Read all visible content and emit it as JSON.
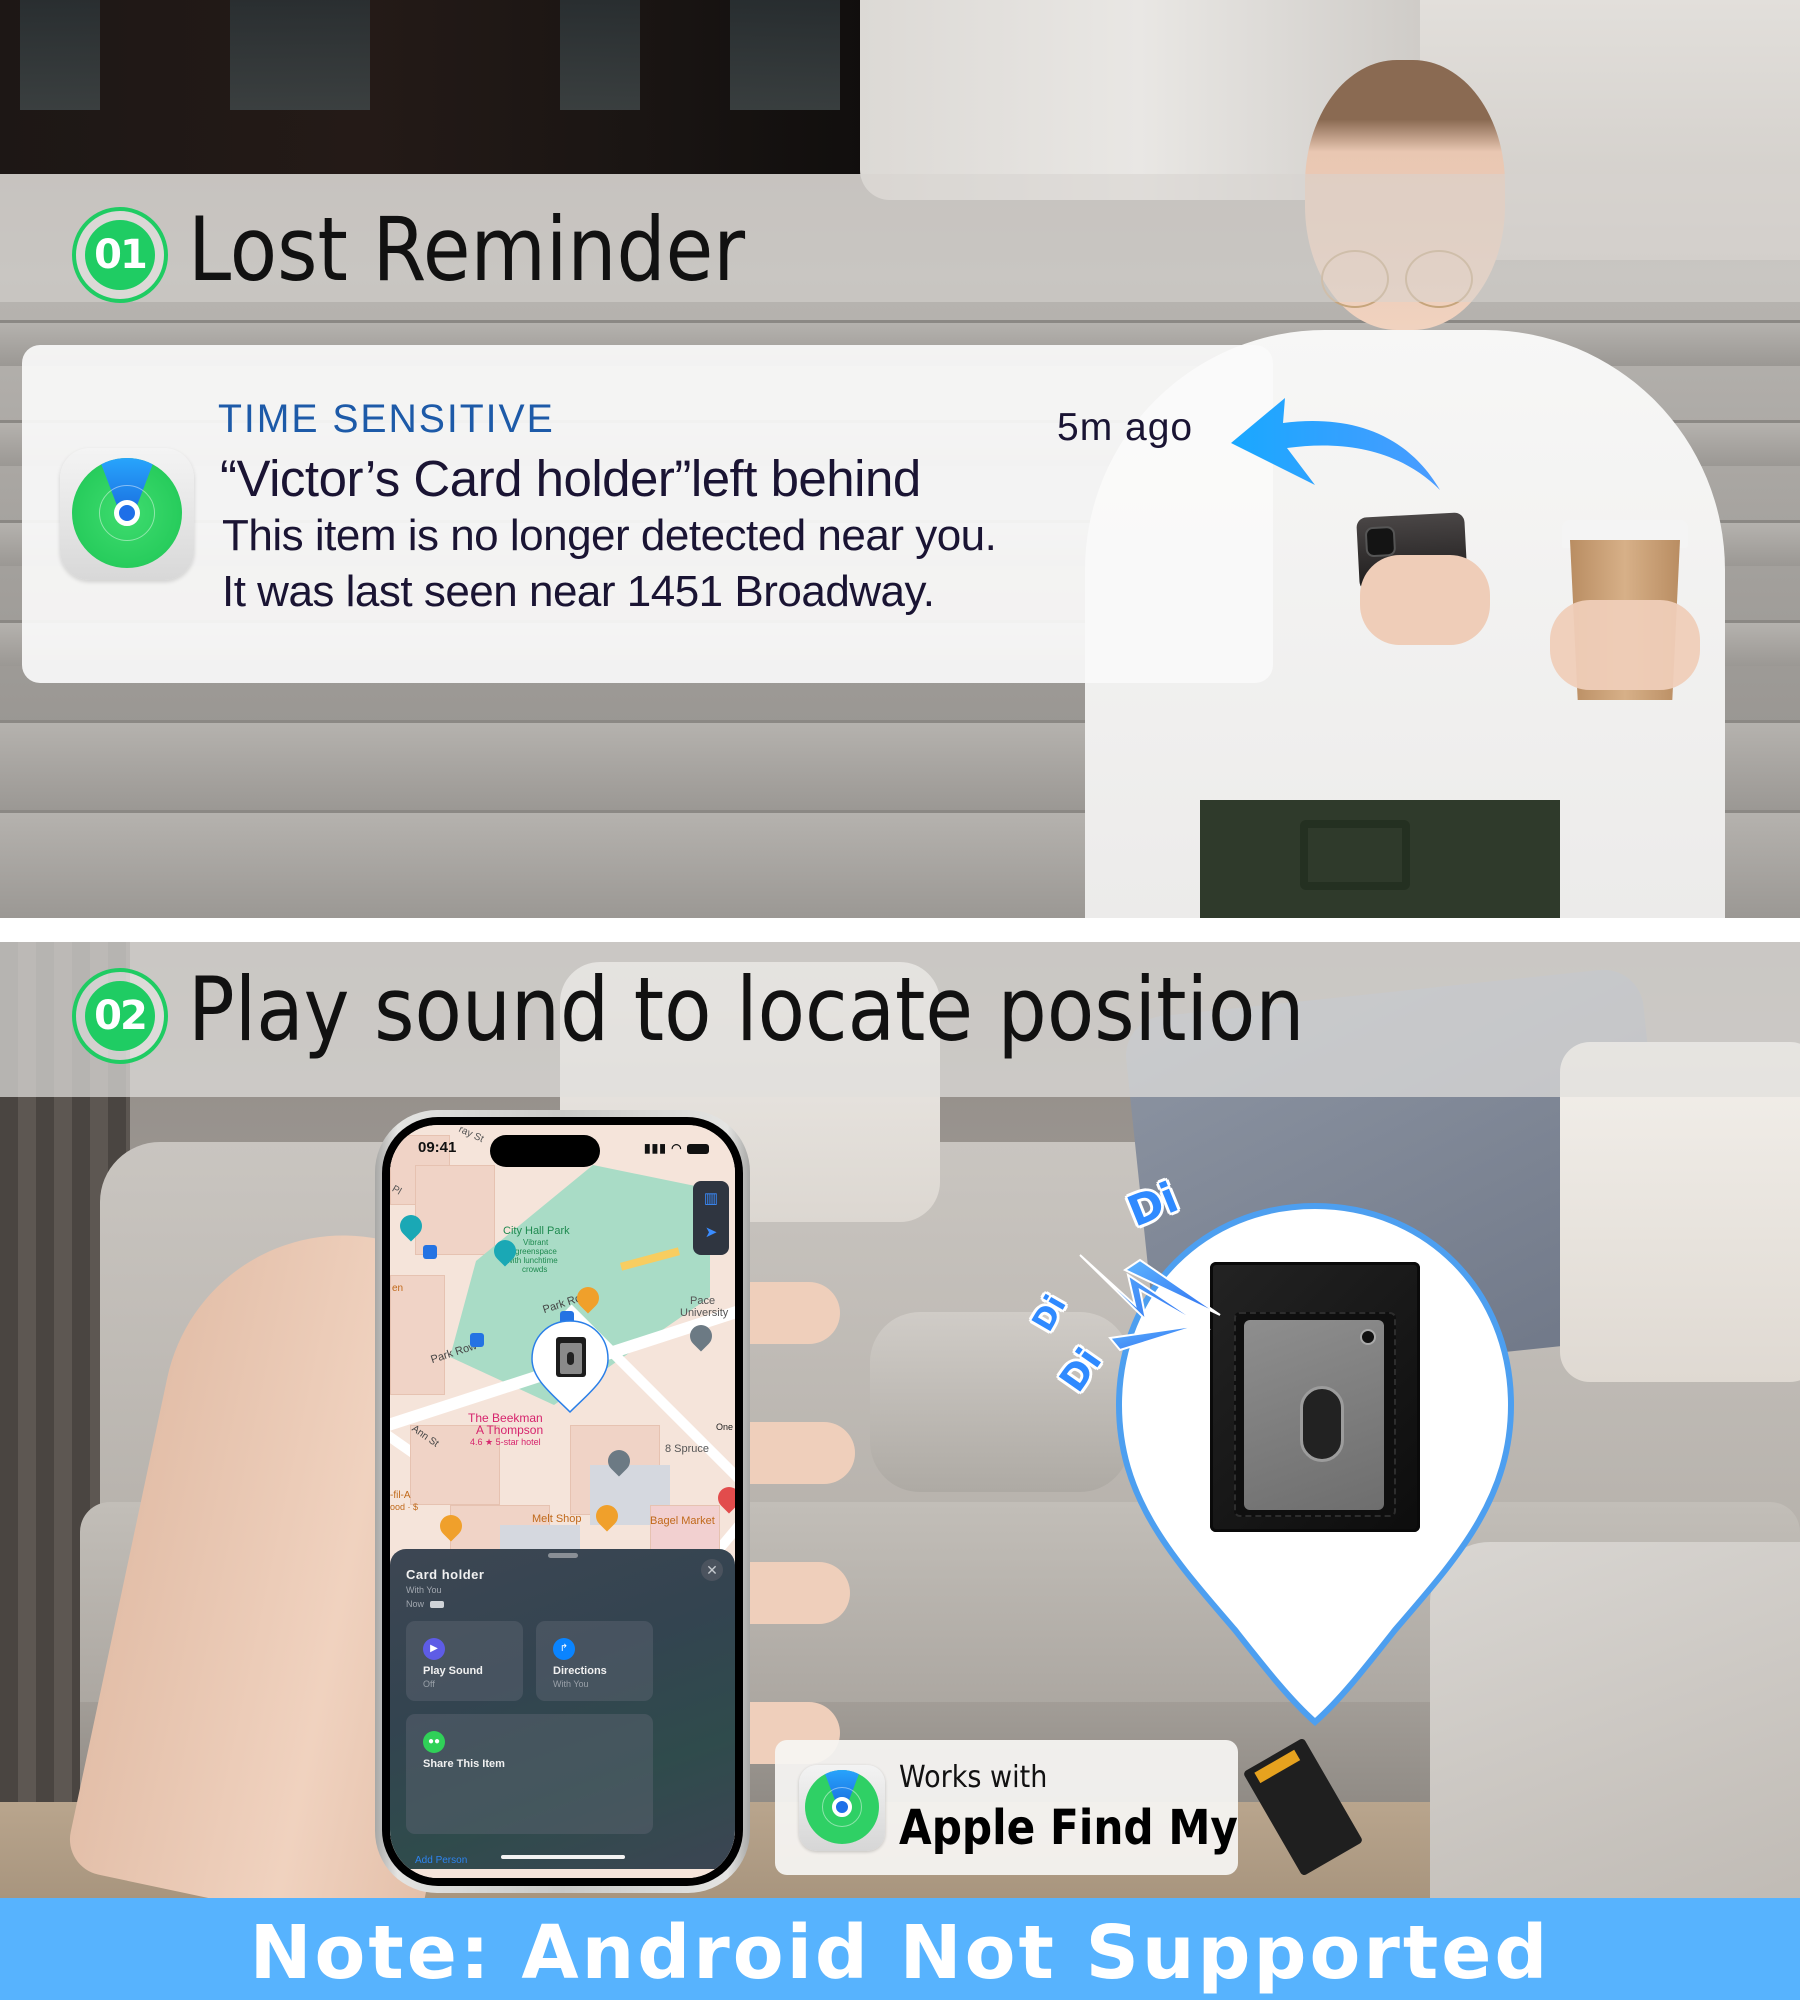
{
  "section1": {
    "badge_number": "01",
    "title": "Lost Reminder",
    "notification": {
      "app_icon": "find-my-icon",
      "category": "TIME SENSITIVE",
      "time": "5m ago",
      "title": "“Victor’s Card holder”left behind",
      "body_line1": "This item is no longer detected near you.",
      "body_line2": "It was last seen near 1451 Broadway."
    }
  },
  "section2": {
    "badge_number": "02",
    "title": "Play sound to locate position",
    "phone": {
      "status_time": "09:41",
      "map_labels": {
        "park_name": "City Hall Park",
        "park_desc1": "Vibrant",
        "park_desc2": "greenspace",
        "park_desc3": "with lunchtime",
        "park_desc4": "crowds",
        "street1": "Park Row",
        "street2": "Park Row",
        "street3": "Ann St",
        "street4": "ray St",
        "street5": "Pl",
        "university1": "Pace",
        "university2": "University",
        "hotel1": "The Beekman",
        "hotel2": "A Thompson",
        "hotel_rating": "4.6 ★ 5-star hotel",
        "spruce": "8 Spruce",
        "one": "One P",
        "melt": "Melt Shop",
        "bagel": "Bagel Market",
        "chick1": "-fil-A",
        "chick2": "ood · $",
        "en": "en"
      },
      "sheet": {
        "item_name": "Card holder",
        "status": "With You",
        "updated": "Now",
        "close_icon": "close-icon",
        "actions": [
          {
            "label": "Play Sound",
            "sub": "Off",
            "icon": "play-icon",
            "color": "#5e5ce6"
          },
          {
            "label": "Directions",
            "sub": "With You",
            "icon": "directions-icon",
            "color": "#0a84ff"
          }
        ],
        "share": {
          "label": "Share This Item",
          "icon": "people-icon",
          "color": "#30d158",
          "link": "Add Person"
        }
      }
    },
    "sound_effect": [
      "Di",
      "Di",
      "Di"
    ],
    "works_with": {
      "line1": "Works with",
      "line2": "Apple Find My"
    }
  },
  "footer_note": "Note: Android Not Supported",
  "colors": {
    "badge_green": "#1fcc63",
    "accent_blue": "#57b3fe",
    "time_sensitive_blue": "#1d5aa8"
  }
}
